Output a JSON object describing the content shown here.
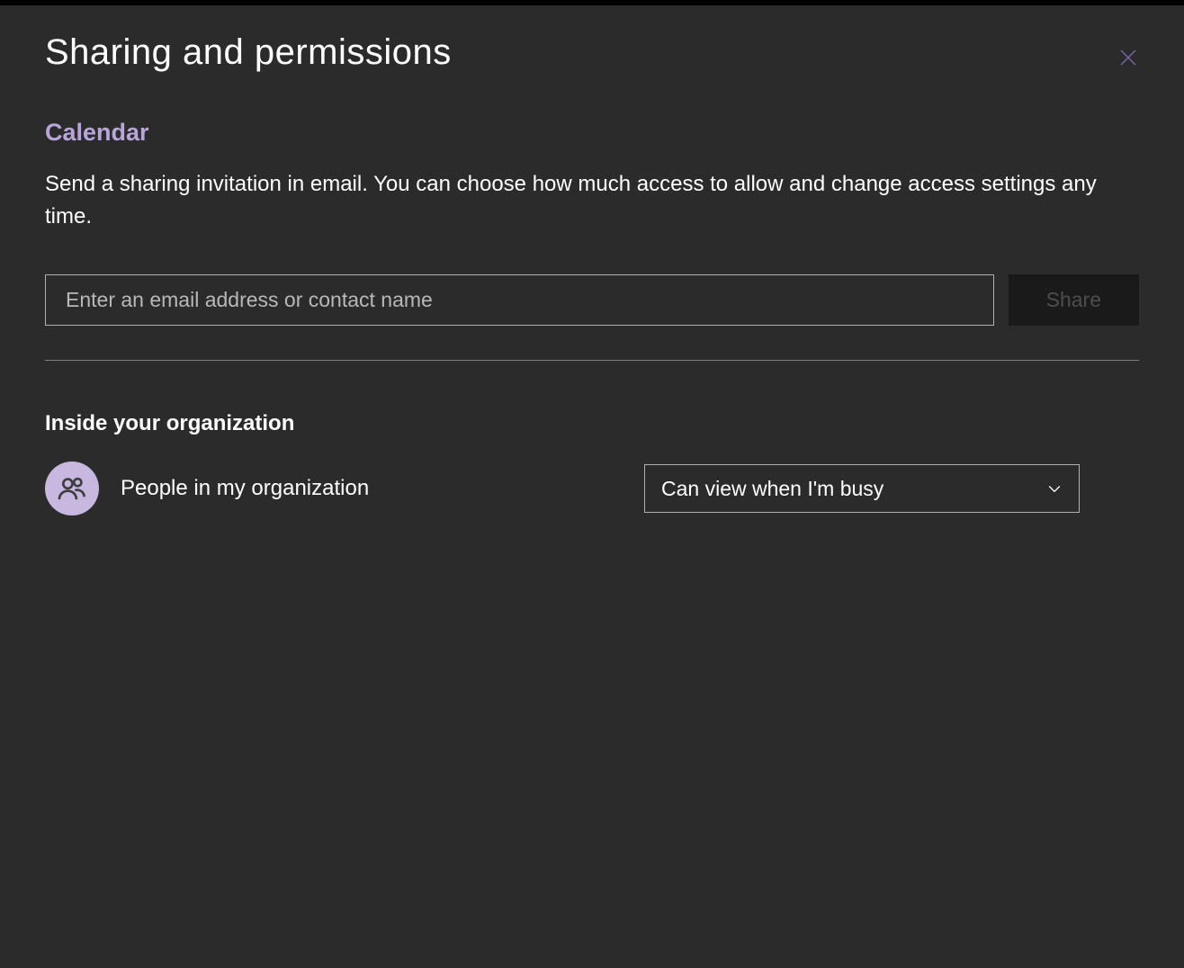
{
  "dialog": {
    "title": "Sharing and permissions",
    "section_heading": "Calendar",
    "description": "Send a sharing invitation in email. You can choose how much access to allow and change access settings any time.",
    "email_placeholder": "Enter an email address or contact name",
    "share_button_label": "Share",
    "subsection_heading": "Inside your organization",
    "organization": {
      "label": "People in my organization",
      "selected_permission": "Can view when I'm busy"
    }
  },
  "colors": {
    "background": "#2b2b2b",
    "accent_purple": "#b8a5da",
    "avatar_bg": "#c8b8e0",
    "close_icon": "#7861a8"
  }
}
